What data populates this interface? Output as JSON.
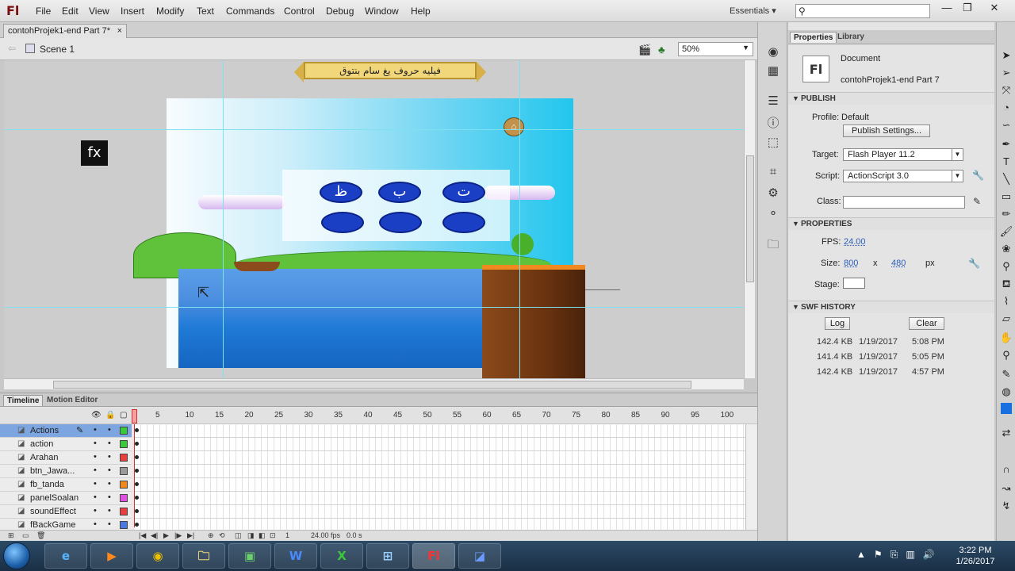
{
  "menubar": {
    "app_logo": "Fl",
    "items": [
      "File",
      "Edit",
      "View",
      "Insert",
      "Modify",
      "Text",
      "Commands",
      "Control",
      "Debug",
      "Window",
      "Help"
    ],
    "workspace": "Essentials",
    "workspace_arrow": "▾",
    "search_placeholder": "",
    "window_controls": [
      "—",
      "❐",
      "✕"
    ]
  },
  "document": {
    "tab_title": "contohProjek1-end Part 7*",
    "tab_close": "×",
    "scene": "Scene 1",
    "zoom": "50%"
  },
  "stage": {
    "banner_text": "فيليه حروف يغ سام بنتوق",
    "fx_label": "fx",
    "letters": [
      "ظ",
      "ب",
      "ت"
    ],
    "home_icon": "home-icon",
    "guide_color": "#7fe0f0"
  },
  "timeline": {
    "tabs": [
      "Timeline",
      "Motion Editor"
    ],
    "frame_numbers": [
      "1",
      "5",
      "10",
      "15",
      "20",
      "25",
      "30",
      "35",
      "40",
      "45",
      "50",
      "55",
      "60",
      "65",
      "70",
      "75",
      "80",
      "85",
      "90",
      "95",
      "100"
    ],
    "layers": [
      {
        "name": "Actions",
        "color": "#3cc83c",
        "selected": true
      },
      {
        "name": "action",
        "color": "#3cc83c",
        "selected": false
      },
      {
        "name": "Arahan",
        "color": "#e84040",
        "selected": false
      },
      {
        "name": "btn_Jawa...",
        "color": "#9a9a9a",
        "selected": false
      },
      {
        "name": "fb_tanda",
        "color": "#f08a20",
        "selected": false
      },
      {
        "name": "panelSoalan",
        "color": "#e050e0",
        "selected": false
      },
      {
        "name": "soundEffect",
        "color": "#e84040",
        "selected": false
      },
      {
        "name": "fBackGame",
        "color": "#4a7ae0",
        "selected": false
      }
    ],
    "footer": {
      "frame": "1",
      "fps": "24.00",
      "fps_unit": "fps",
      "time": "0.0 s"
    }
  },
  "properties": {
    "tabs": [
      "Properties",
      "Library"
    ],
    "doc_badge": "Fl",
    "doc_type": "Document",
    "doc_name": "contohProjek1-end Part 7",
    "publish": {
      "header": "PUBLISH",
      "profile_label": "Profile:",
      "profile_value": "Default",
      "publish_settings": "Publish Settings...",
      "target_label": "Target:",
      "target_value": "Flash Player 11.2",
      "script_label": "Script:",
      "script_value": "ActionScript 3.0",
      "class_label": "Class:",
      "class_value": ""
    },
    "props": {
      "header": "PROPERTIES",
      "fps_label": "FPS:",
      "fps_value": "24.00",
      "size_label": "Size:",
      "width": "800",
      "x": "x",
      "height": "480",
      "unit": "px",
      "stage_label": "Stage:",
      "stage_color": "#ffffff"
    },
    "swf_history": {
      "header": "SWF HISTORY",
      "log": "Log",
      "clear": "Clear",
      "rows": [
        {
          "size": "142.4 KB",
          "date": "1/19/2017",
          "time": "5:08 PM"
        },
        {
          "size": "141.4 KB",
          "date": "1/19/2017",
          "time": "5:05 PM"
        },
        {
          "size": "142.4 KB",
          "date": "1/19/2017",
          "time": "4:57 PM"
        }
      ]
    }
  },
  "taskbar": {
    "time": "3:22 PM",
    "date": "1/26/2017",
    "apps": [
      "ie-icon",
      "media-player-icon",
      "chrome-icon",
      "explorer-icon",
      "desktop-icon",
      "word-icon",
      "excel-icon",
      "network-icon",
      "flash-icon",
      "screen-capture-icon"
    ]
  }
}
